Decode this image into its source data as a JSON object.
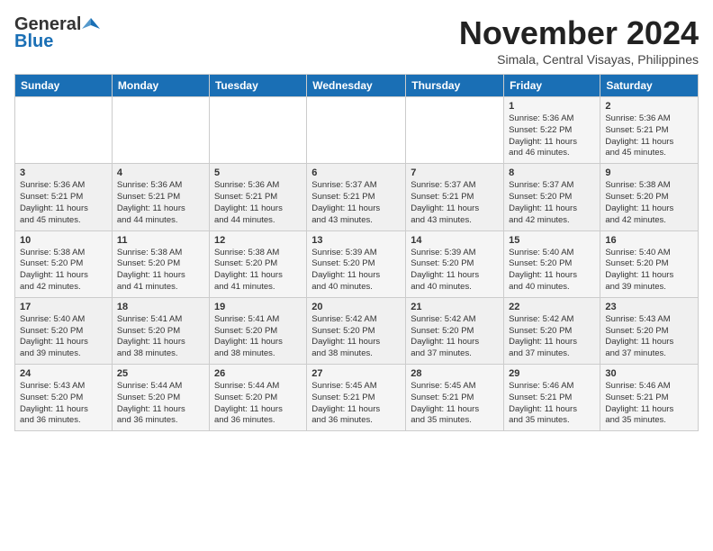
{
  "header": {
    "logo_line1": "General",
    "logo_line2": "Blue",
    "title": "November 2024",
    "subtitle": "Simala, Central Visayas, Philippines"
  },
  "calendar": {
    "days_of_week": [
      "Sunday",
      "Monday",
      "Tuesday",
      "Wednesday",
      "Thursday",
      "Friday",
      "Saturday"
    ],
    "weeks": [
      [
        {
          "day": "",
          "info": ""
        },
        {
          "day": "",
          "info": ""
        },
        {
          "day": "",
          "info": ""
        },
        {
          "day": "",
          "info": ""
        },
        {
          "day": "",
          "info": ""
        },
        {
          "day": "1",
          "info": "Sunrise: 5:36 AM\nSunset: 5:22 PM\nDaylight: 11 hours\nand 46 minutes."
        },
        {
          "day": "2",
          "info": "Sunrise: 5:36 AM\nSunset: 5:21 PM\nDaylight: 11 hours\nand 45 minutes."
        }
      ],
      [
        {
          "day": "3",
          "info": "Sunrise: 5:36 AM\nSunset: 5:21 PM\nDaylight: 11 hours\nand 45 minutes."
        },
        {
          "day": "4",
          "info": "Sunrise: 5:36 AM\nSunset: 5:21 PM\nDaylight: 11 hours\nand 44 minutes."
        },
        {
          "day": "5",
          "info": "Sunrise: 5:36 AM\nSunset: 5:21 PM\nDaylight: 11 hours\nand 44 minutes."
        },
        {
          "day": "6",
          "info": "Sunrise: 5:37 AM\nSunset: 5:21 PM\nDaylight: 11 hours\nand 43 minutes."
        },
        {
          "day": "7",
          "info": "Sunrise: 5:37 AM\nSunset: 5:21 PM\nDaylight: 11 hours\nand 43 minutes."
        },
        {
          "day": "8",
          "info": "Sunrise: 5:37 AM\nSunset: 5:20 PM\nDaylight: 11 hours\nand 42 minutes."
        },
        {
          "day": "9",
          "info": "Sunrise: 5:38 AM\nSunset: 5:20 PM\nDaylight: 11 hours\nand 42 minutes."
        }
      ],
      [
        {
          "day": "10",
          "info": "Sunrise: 5:38 AM\nSunset: 5:20 PM\nDaylight: 11 hours\nand 42 minutes."
        },
        {
          "day": "11",
          "info": "Sunrise: 5:38 AM\nSunset: 5:20 PM\nDaylight: 11 hours\nand 41 minutes."
        },
        {
          "day": "12",
          "info": "Sunrise: 5:38 AM\nSunset: 5:20 PM\nDaylight: 11 hours\nand 41 minutes."
        },
        {
          "day": "13",
          "info": "Sunrise: 5:39 AM\nSunset: 5:20 PM\nDaylight: 11 hours\nand 40 minutes."
        },
        {
          "day": "14",
          "info": "Sunrise: 5:39 AM\nSunset: 5:20 PM\nDaylight: 11 hours\nand 40 minutes."
        },
        {
          "day": "15",
          "info": "Sunrise: 5:40 AM\nSunset: 5:20 PM\nDaylight: 11 hours\nand 40 minutes."
        },
        {
          "day": "16",
          "info": "Sunrise: 5:40 AM\nSunset: 5:20 PM\nDaylight: 11 hours\nand 39 minutes."
        }
      ],
      [
        {
          "day": "17",
          "info": "Sunrise: 5:40 AM\nSunset: 5:20 PM\nDaylight: 11 hours\nand 39 minutes."
        },
        {
          "day": "18",
          "info": "Sunrise: 5:41 AM\nSunset: 5:20 PM\nDaylight: 11 hours\nand 38 minutes."
        },
        {
          "day": "19",
          "info": "Sunrise: 5:41 AM\nSunset: 5:20 PM\nDaylight: 11 hours\nand 38 minutes."
        },
        {
          "day": "20",
          "info": "Sunrise: 5:42 AM\nSunset: 5:20 PM\nDaylight: 11 hours\nand 38 minutes."
        },
        {
          "day": "21",
          "info": "Sunrise: 5:42 AM\nSunset: 5:20 PM\nDaylight: 11 hours\nand 37 minutes."
        },
        {
          "day": "22",
          "info": "Sunrise: 5:42 AM\nSunset: 5:20 PM\nDaylight: 11 hours\nand 37 minutes."
        },
        {
          "day": "23",
          "info": "Sunrise: 5:43 AM\nSunset: 5:20 PM\nDaylight: 11 hours\nand 37 minutes."
        }
      ],
      [
        {
          "day": "24",
          "info": "Sunrise: 5:43 AM\nSunset: 5:20 PM\nDaylight: 11 hours\nand 36 minutes."
        },
        {
          "day": "25",
          "info": "Sunrise: 5:44 AM\nSunset: 5:20 PM\nDaylight: 11 hours\nand 36 minutes."
        },
        {
          "day": "26",
          "info": "Sunrise: 5:44 AM\nSunset: 5:20 PM\nDaylight: 11 hours\nand 36 minutes."
        },
        {
          "day": "27",
          "info": "Sunrise: 5:45 AM\nSunset: 5:21 PM\nDaylight: 11 hours\nand 36 minutes."
        },
        {
          "day": "28",
          "info": "Sunrise: 5:45 AM\nSunset: 5:21 PM\nDaylight: 11 hours\nand 35 minutes."
        },
        {
          "day": "29",
          "info": "Sunrise: 5:46 AM\nSunset: 5:21 PM\nDaylight: 11 hours\nand 35 minutes."
        },
        {
          "day": "30",
          "info": "Sunrise: 5:46 AM\nSunset: 5:21 PM\nDaylight: 11 hours\nand 35 minutes."
        }
      ]
    ]
  }
}
